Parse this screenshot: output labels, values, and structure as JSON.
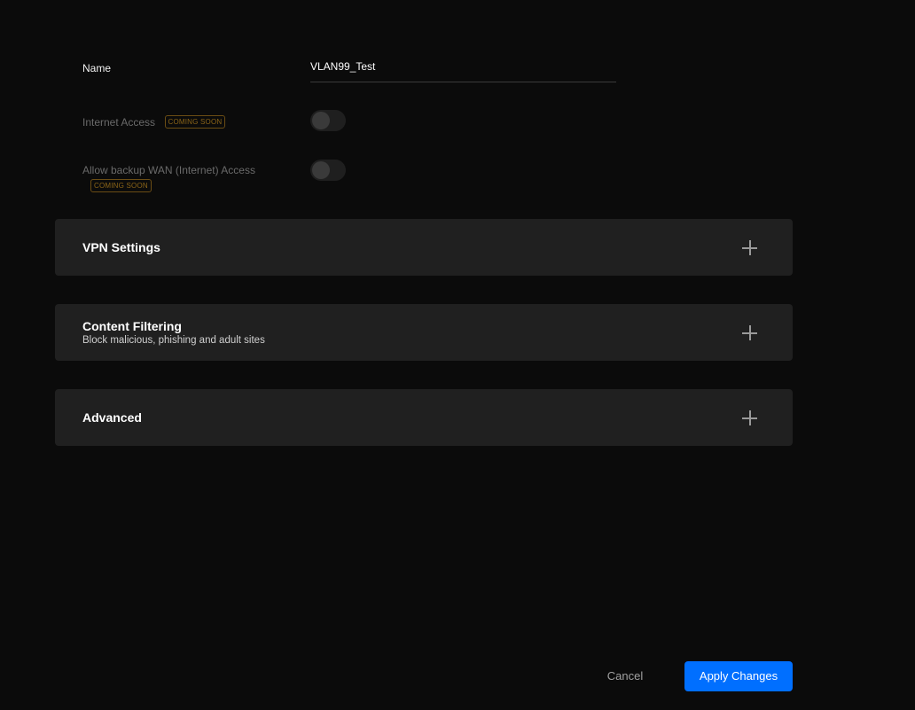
{
  "form": {
    "name": {
      "label": "Name",
      "value": "VLAN99_Test"
    },
    "internet_access": {
      "label": "Internet Access",
      "badge": "COMING SOON",
      "enabled": false
    },
    "backup_wan": {
      "label": "Allow backup WAN (Internet) Access",
      "badge": "COMING SOON",
      "enabled": false
    }
  },
  "sections": {
    "vpn": {
      "title": "VPN Settings"
    },
    "content_filtering": {
      "title": "Content Filtering",
      "subtitle": "Block malicious, phishing and adult sites"
    },
    "advanced": {
      "title": "Advanced"
    }
  },
  "actions": {
    "cancel_label": "Cancel",
    "apply_label": "Apply Changes"
  },
  "colors": {
    "background": "#0b0b0b",
    "panel": "#202020",
    "accent": "#006fff",
    "badge": "#8a6418"
  },
  "icons": {
    "expand": "plus-icon"
  }
}
